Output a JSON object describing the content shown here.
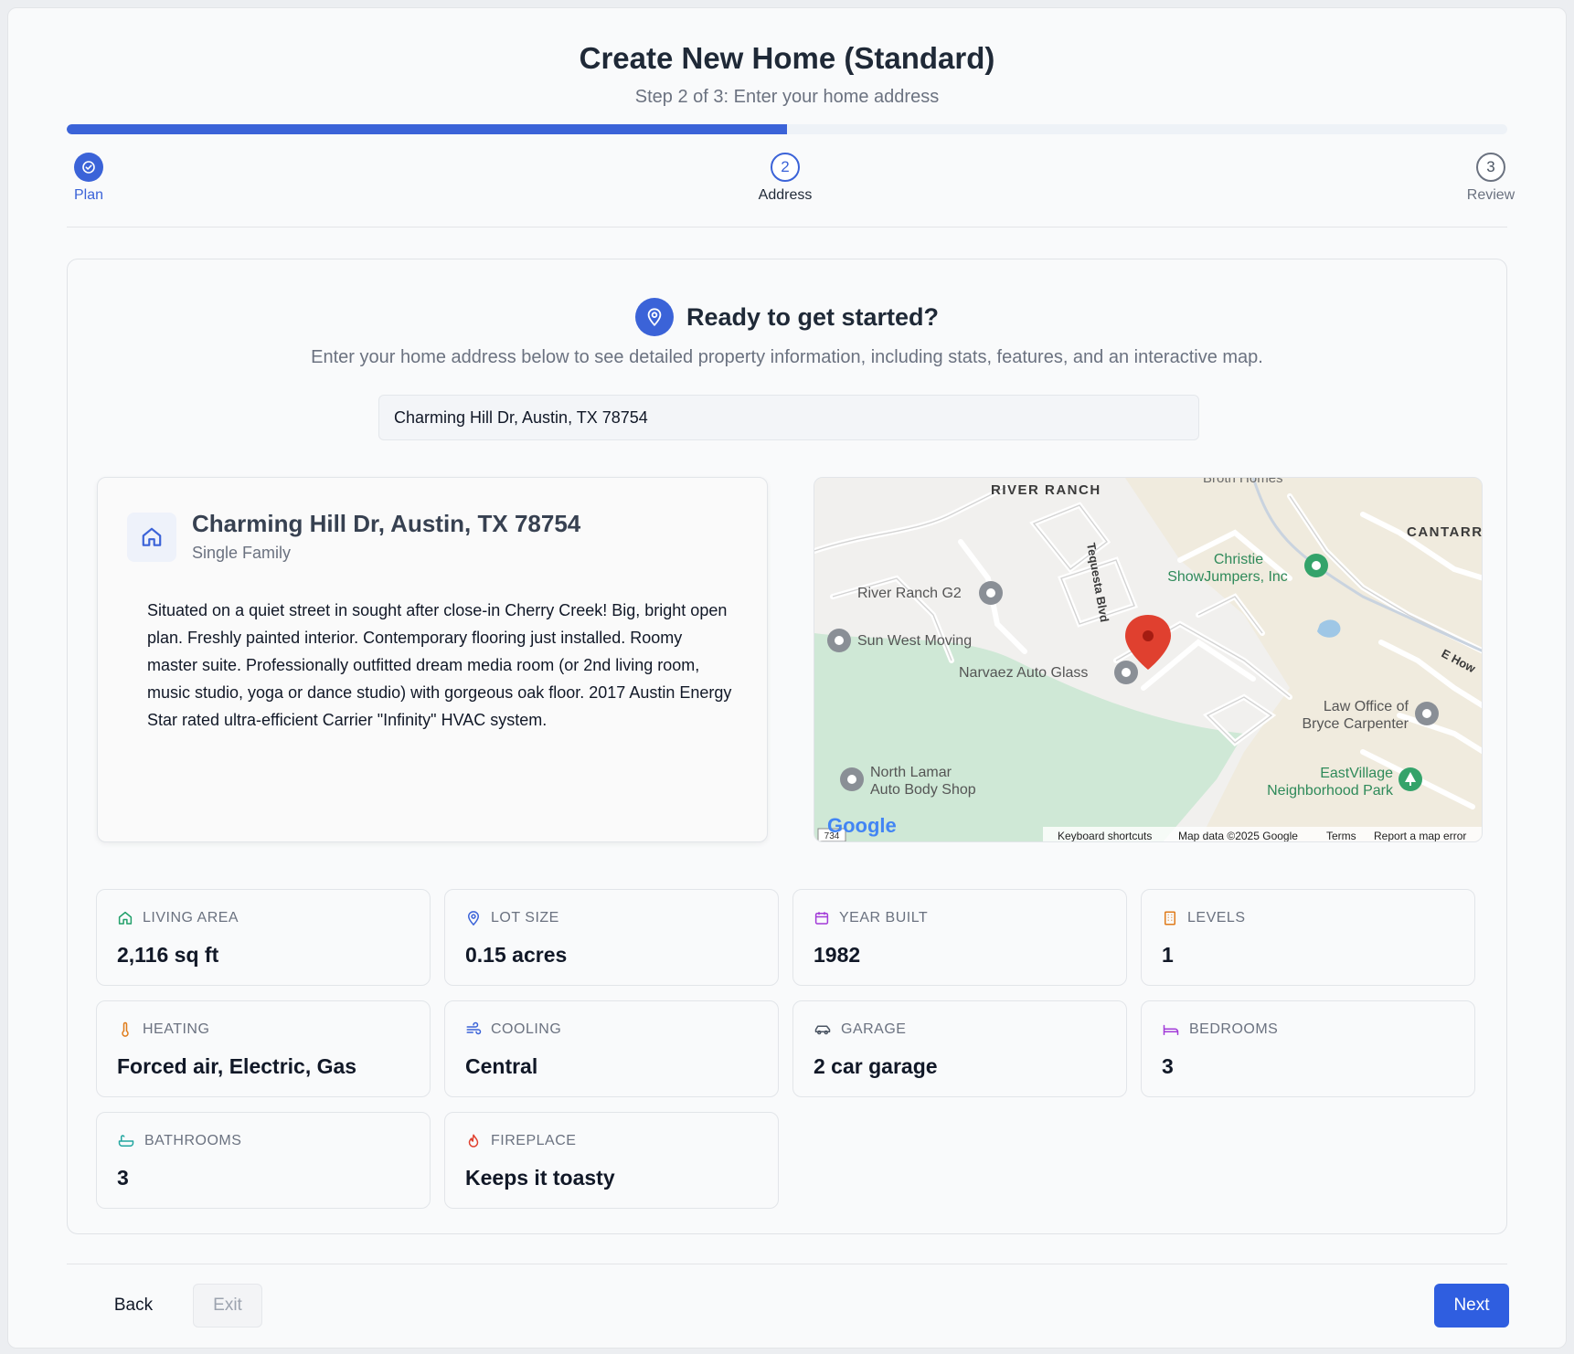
{
  "header": {
    "title": "Create New Home (Standard)",
    "subtitle": "Step 2 of 3: Enter your home address"
  },
  "progress": {
    "percent": 50
  },
  "steps": [
    {
      "number": "",
      "label": "Plan",
      "state": "complete"
    },
    {
      "number": "2",
      "label": "Address",
      "state": "current"
    },
    {
      "number": "3",
      "label": "Review",
      "state": "upcoming"
    }
  ],
  "intro": {
    "heading": "Ready to get started?",
    "text": "Enter your home address below to see detailed property information, including stats, features, and an interactive map."
  },
  "address_input": {
    "value": "Charming Hill Dr, Austin, TX 78754"
  },
  "property": {
    "title": "Charming Hill Dr, Austin, TX 78754",
    "type": "Single Family",
    "description": "Situated on a quiet street in sought after close-in Cherry Creek! Big, bright open plan. Freshly painted interior. Contemporary flooring just installed. Roomy master suite. Professionally outfitted dream media room (or 2nd living room, music studio, yoga or dance studio) with gorgeous oak floor. 2017 Austin Energy Star rated ultra-efficient Carrier \"Infinity\" HVAC system."
  },
  "map": {
    "labels": {
      "river_ranch": "RIVER RANCH",
      "broth_homes": "Broth Homes",
      "cantarra": "CANTARR",
      "tequesta": "Tequesta Blvd",
      "christie_1": "Christie",
      "christie_2": "ShowJumpers, Inc",
      "river_ranch_g2": "River Ranch G2",
      "sun_west": "Sun West Moving",
      "narvaez": "Narvaez Auto Glass",
      "e_howard": "E How",
      "law_1": "Law Office of",
      "law_2": "Bryce Carpenter",
      "eastvillage_1": "EastVillage",
      "eastvillage_2": "Neighborhood Park",
      "north_lamar_1": "North Lamar",
      "north_lamar_2": "Auto Body Shop",
      "road_734": "734"
    },
    "google_logo": "Google",
    "footer": {
      "shortcuts": "Keyboard shortcuts",
      "map_data": "Map data ©2025 Google",
      "terms": "Terms",
      "report": "Report a map error"
    }
  },
  "stats": [
    {
      "icon": "home-icon",
      "label": "LIVING AREA",
      "value": "2,116 sq ft",
      "color": "#22a06b"
    },
    {
      "icon": "location-pin-icon",
      "label": "LOT SIZE",
      "value": "0.15 acres",
      "color": "#3b63d8"
    },
    {
      "icon": "calendar-icon",
      "label": "YEAR BUILT",
      "value": "1982",
      "color": "#a23bd8"
    },
    {
      "icon": "building-icon",
      "label": "LEVELS",
      "value": "1",
      "color": "#e07b1a"
    },
    {
      "icon": "thermometer-icon",
      "label": "HEATING",
      "value": "Forced air, Electric, Gas",
      "color": "#e07b1a"
    },
    {
      "icon": "wind-icon",
      "label": "COOLING",
      "value": "Central",
      "color": "#3b63d8"
    },
    {
      "icon": "car-icon",
      "label": "GARAGE",
      "value": "2 car garage",
      "color": "#4b5563"
    },
    {
      "icon": "bed-icon",
      "label": "BEDROOMS",
      "value": "3",
      "color": "#a23bd8"
    },
    {
      "icon": "bath-icon",
      "label": "BATHROOMS",
      "value": "3",
      "color": "#22a6a0"
    },
    {
      "icon": "flame-icon",
      "label": "FIREPLACE",
      "value": "Keeps it toasty",
      "color": "#e0402f"
    }
  ],
  "footer": {
    "back": "Back",
    "exit": "Exit",
    "next": "Next"
  },
  "colors": {
    "accent": "#3b63d8",
    "next_button": "#2f5ee0",
    "park_green": "#cfe8d6",
    "map_pin": "#e0402f"
  }
}
